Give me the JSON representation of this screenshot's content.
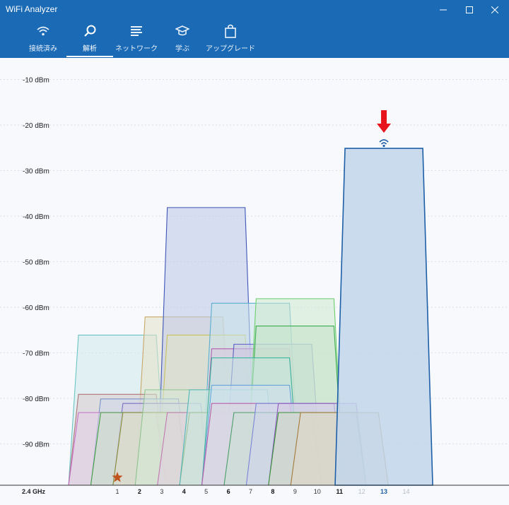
{
  "window": {
    "title": "WiFi Analyzer",
    "buttons": [
      "minimize-button",
      "maximize-button",
      "close-button"
    ]
  },
  "tabs": [
    {
      "label": "接続済み",
      "icon": "wifi-icon",
      "active": false
    },
    {
      "label": "解析",
      "icon": "magnify-icon",
      "active": true
    },
    {
      "label": "ネットワーク",
      "icon": "list-icon",
      "active": false
    },
    {
      "label": "学ぶ",
      "icon": "graduation-cap-icon",
      "active": false
    },
    {
      "label": "アップグレード",
      "icon": "shopping-bag-icon",
      "active": false
    }
  ],
  "chart_data": {
    "type": "area",
    "band_label": "2.4 GHz",
    "y_ticks": [
      "-10 dBm",
      "-20 dBm",
      "-30 dBm",
      "-40 dBm",
      "-50 dBm",
      "-60 dBm",
      "-70 dBm",
      "-80 dBm",
      "-90 dBm"
    ],
    "y_values": [
      -10,
      -20,
      -30,
      -40,
      -50,
      -60,
      -70,
      -80,
      -90
    ],
    "ylim": [
      -100,
      -5
    ],
    "channels": [
      "1",
      "2",
      "3",
      "4",
      "5",
      "6",
      "7",
      "8",
      "9",
      "10",
      "11",
      "12",
      "13",
      "14"
    ],
    "channel_styles": [
      "normal",
      "bold",
      "normal",
      "bold",
      "normal",
      "bold",
      "normal",
      "bold",
      "normal",
      "normal",
      "bold",
      "faded",
      "highlight",
      "faded"
    ],
    "connected_channel": 13,
    "favorite_channel": 1,
    "series": [
      {
        "center": 1,
        "signal": -65.5,
        "color": "#6cc4c4",
        "fill": "#cfeaea"
      },
      {
        "center": 4,
        "signal": -61.5,
        "color": "#c8a86a",
        "fill": "#e6e1c8"
      },
      {
        "center": 5,
        "signal": -37.5,
        "color": "#3d55b8",
        "fill": "#bcc6e6"
      },
      {
        "center": 5,
        "signal": -65.5,
        "color": "#c9c25e",
        "fill": "#e2e4c4"
      },
      {
        "center": 7,
        "signal": -58.5,
        "color": "#5aaecd",
        "fill": "#c9e2ea"
      },
      {
        "center": 7,
        "signal": -68.5,
        "color": "#b05fb0",
        "fill": "#dbc7de"
      },
      {
        "center": 8,
        "signal": -67.5,
        "color": "#5b5ec5",
        "fill": "#cbcbe6"
      },
      {
        "center": 9,
        "signal": -57.5,
        "color": "#6ccf6c",
        "fill": "#cde9cd"
      },
      {
        "center": 9,
        "signal": -63.5,
        "color": "#3cad4f",
        "fill": "#c3e2c8"
      },
      {
        "center": 1,
        "signal": -78.5,
        "color": "#b07575",
        "fill": "#dccccf"
      },
      {
        "center": 2,
        "signal": -79.5,
        "color": "#7b94c8",
        "fill": "#d0d8e8"
      },
      {
        "center": 3,
        "signal": -80.5,
        "color": "#7c6fc0",
        "fill": "#d4d0e8"
      },
      {
        "center": 1,
        "signal": -82.5,
        "color": "#c86ec8",
        "fill": "#e3d0e8"
      },
      {
        "center": 2,
        "signal": -82.5,
        "color": "#43a043",
        "fill": "#c9dec9"
      },
      {
        "center": 3,
        "signal": -82.5,
        "color": "#8a8a3a",
        "fill": "#dcdcc8"
      },
      {
        "center": 4,
        "signal": -77.5,
        "color": "#8fc48f",
        "fill": "#d6e7d6"
      },
      {
        "center": 5,
        "signal": -82.5,
        "color": "#c07ab0",
        "fill": "#e2d0e0"
      },
      {
        "center": 6,
        "signal": -82.5,
        "color": "#6a9a3a",
        "fill": "#d4e0c8"
      },
      {
        "center": 6,
        "signal": -77.5,
        "color": "#52b5b5",
        "fill": "#cbe6e6"
      },
      {
        "center": 7,
        "signal": -70.5,
        "color": "#3fb6a0",
        "fill": "#c9e6e0"
      },
      {
        "center": 7,
        "signal": -76.5,
        "color": "#67a5d9",
        "fill": "#cfe0ee"
      },
      {
        "center": 7,
        "signal": -80.5,
        "color": "#b85fa8",
        "fill": "#e2cfe0"
      },
      {
        "center": 8,
        "signal": -82.5,
        "color": "#4d9e6a",
        "fill": "#c9e0d2"
      },
      {
        "center": 9,
        "signal": -80.5,
        "color": "#7c84d6",
        "fill": "#d0d4ee"
      },
      {
        "center": 10,
        "signal": -82.5,
        "color": "#c45c5c",
        "fill": "#e6cccc"
      },
      {
        "center": 10,
        "signal": -80.5,
        "color": "#8e58c0",
        "fill": "#d8cce6"
      },
      {
        "center": 10,
        "signal": -82.5,
        "color": "#3c9c3c",
        "fill": "#c8dec8"
      },
      {
        "center": 11,
        "signal": -82.5,
        "color": "#a27a3a",
        "fill": "#e0d6c4"
      },
      {
        "center": 13,
        "signal": -24.5,
        "color": "#1e5fa8",
        "fill": "#c2d6ea",
        "connected": true
      }
    ]
  }
}
